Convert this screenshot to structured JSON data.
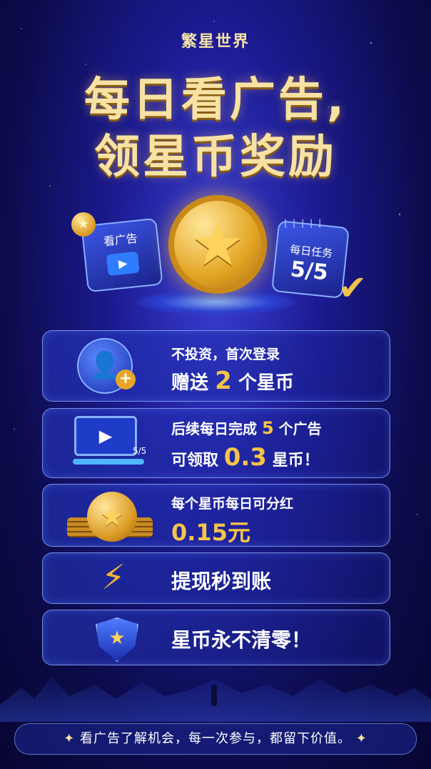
{
  "brand": "繁星世界",
  "headline": {
    "line1": "每日看广告,",
    "line2": "领星币奖励"
  },
  "hero": {
    "ad_panel_label": "看广告",
    "task_label": "每日任务",
    "task_value": "5/5"
  },
  "cards": [
    {
      "line1": "不投资，首次登录",
      "line2_prefix": "赠送",
      "line2_highlight": "2",
      "line2_suffix": "个星币"
    },
    {
      "line1_prefix": "后续每日完成",
      "line1_highlight": "5",
      "line1_suffix": "个广告",
      "line2_prefix": "可领取",
      "line2_highlight": "0.3",
      "line2_suffix": "星币！",
      "progress_label": "5/5"
    },
    {
      "line1": "每个星币每日可分红",
      "line2": "0.15元"
    },
    {
      "line1": "提现秒到账"
    },
    {
      "line1": "星币永不清零！"
    }
  ],
  "footer": {
    "text": "看广告了解机会，每一次参与，都留下价值。"
  },
  "colors": {
    "gold": "#f5c349",
    "bg_deep": "#0c0b4a",
    "bg_glow": "#3a3fd6"
  },
  "icons": [
    "coin-icon",
    "play-icon",
    "calendar-icon",
    "check-icon",
    "user-icon",
    "plus-icon",
    "bolt-icon",
    "shield-icon",
    "star-icon"
  ]
}
